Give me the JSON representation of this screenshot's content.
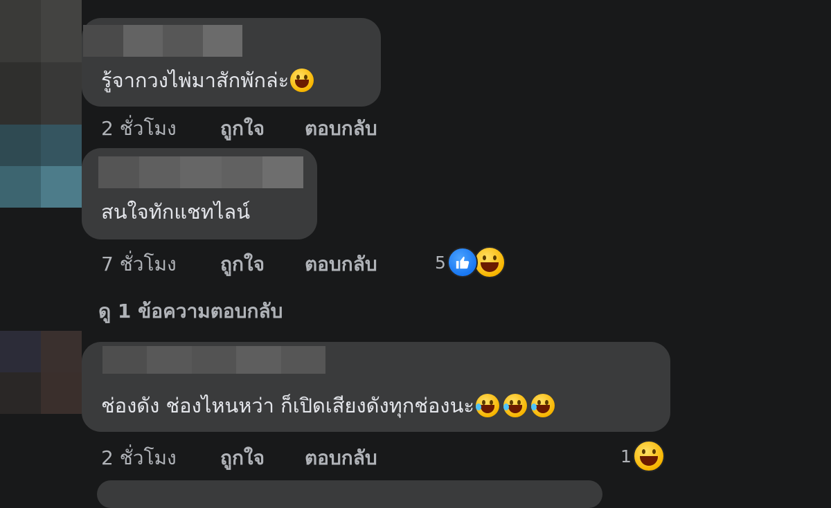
{
  "comments": [
    {
      "text": "รู้จากวงไพ่มาสักพักล่ะ",
      "time": "2 ชั่วโมง",
      "like": "ถูกใจ",
      "reply": "ตอบกลับ",
      "reaction_count": null
    },
    {
      "text": "สนใจทักแชทไลน์",
      "time": "7 ชั่วโมง",
      "like": "ถูกใจ",
      "reply": "ตอบกลับ",
      "reaction_count": "5",
      "reactions": [
        "like-icon",
        "haha-icon"
      ],
      "view_replies": "ดู 1 ข้อความตอบกลับ"
    },
    {
      "text": "ช่องดัง ช่องไหนหว่า ก็เปิดเสียงดังทุกช่องนะ",
      "time": "2 ชั่วโมง",
      "like": "ถูกใจ",
      "reply": "ตอบกลับ",
      "reaction_count": "1",
      "reactions": [
        "haha-icon"
      ],
      "trailing_emojis": [
        "rofl-emoji",
        "rofl-emoji",
        "rofl-emoji"
      ]
    }
  ],
  "colors": {
    "background": "#18191a",
    "bubble": "#3a3b3c",
    "text": "#e4e6eb",
    "meta": "#b0b3b8",
    "like_blue": "#1877f2"
  }
}
